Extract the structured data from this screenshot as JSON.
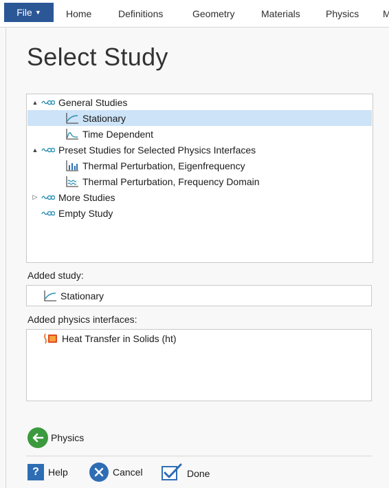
{
  "ribbon": {
    "file_label": "File",
    "tabs": [
      "Home",
      "Definitions",
      "Geometry",
      "Materials",
      "Physics",
      "M"
    ]
  },
  "page": {
    "title": "Select Study"
  },
  "tree": {
    "items": [
      {
        "label": "General Studies",
        "expander": "▲",
        "icon": "study-group-icon"
      },
      {
        "label": "Stationary",
        "icon": "stationary-icon",
        "selected": true
      },
      {
        "label": "Time Dependent",
        "icon": "time-dependent-icon"
      },
      {
        "label": "Preset Studies for Selected Physics Interfaces",
        "expander": "▲",
        "icon": "study-group-icon"
      },
      {
        "label": "Thermal Perturbation, Eigenfrequency",
        "icon": "eigenfrequency-icon"
      },
      {
        "label": "Thermal Perturbation, Frequency Domain",
        "icon": "frequency-domain-icon"
      },
      {
        "label": "More Studies",
        "expander": "▷",
        "icon": "study-group-icon"
      },
      {
        "label": "Empty Study",
        "icon": "study-group-icon"
      }
    ]
  },
  "added_study": {
    "label": "Added study:",
    "value": "Stationary"
  },
  "added_physics": {
    "label": "Added physics interfaces:",
    "items": [
      "Heat Transfer in Solids (ht)"
    ]
  },
  "navigation": {
    "back_label": "Physics"
  },
  "footer": {
    "help": "Help",
    "cancel": "Cancel",
    "done": "Done"
  },
  "colors": {
    "file_tab": "#2b5797",
    "selection": "#cde3f7",
    "back_button": "#3b9a3d",
    "accent": "#2e6db4"
  }
}
